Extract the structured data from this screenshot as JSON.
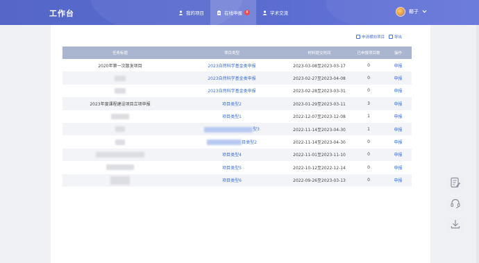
{
  "header": {
    "brand": "工作台",
    "nav": [
      {
        "label": "我的项目",
        "icon": "user-icon"
      },
      {
        "label": "在线申报",
        "icon": "clipboard-icon",
        "badge": "8"
      },
      {
        "label": "学术交流",
        "icon": "people-icon"
      }
    ],
    "user_name": "椰子"
  },
  "actions": {
    "apply_horizontal": "申请横向项目",
    "export": "导出"
  },
  "table": {
    "headers": [
      "任务标题",
      "项目类型",
      "材料提交时间",
      "已申报项目数",
      "操作"
    ],
    "rows": [
      {
        "title": "2020年第一次散发项目",
        "type": "2023自然科学基金类申报",
        "time": "2023-03-08至2023-03-17",
        "count": "0",
        "op": "申报"
      },
      {
        "title": "",
        "type": "2023自然科学基金类申报",
        "time": "2023-02-27至2023-04-08",
        "count": "0",
        "op": "申报"
      },
      {
        "title": "",
        "type": "2023自然科学基金类申报",
        "time": "2023-02-28至2023-03-31",
        "count": "0",
        "op": "申报"
      },
      {
        "title": "2023年度课程建设项目立项申报",
        "type": "项目类型2",
        "time": "2023-01-29至2023-03-11",
        "count": "3",
        "op": "申报"
      },
      {
        "title": "",
        "type": "项目类型1",
        "time": "2022-12-07至2023-12-08",
        "count": "1",
        "op": "申报"
      },
      {
        "title": "",
        "type": "型3",
        "time": "2022-11-14至2023-04-30",
        "count": "1",
        "op": "申报"
      },
      {
        "title": "",
        "type": "目类型2",
        "time": "2022-11-14至2023-04-30",
        "count": "0",
        "op": "申报"
      },
      {
        "title": "",
        "type": "项目类型4",
        "time": "2022-11-01至2023-11-10",
        "count": "0",
        "op": "申报"
      },
      {
        "title": "",
        "type": "项目类型5",
        "time": "2022-10-12至2022-12-14",
        "count": "0",
        "op": "申报"
      },
      {
        "title": "",
        "type": "项目类型6",
        "time": "2022-09-26至2023-03-13",
        "count": "0",
        "op": "申报"
      }
    ]
  },
  "float_tools": [
    {
      "icon": "edit-note-icon"
    },
    {
      "icon": "headset-icon"
    },
    {
      "icon": "download-icon"
    }
  ],
  "colors": {
    "header": "#5566c8",
    "link": "#3c6fd8",
    "table_header": "#aab5cf",
    "badge": "#f04848"
  }
}
